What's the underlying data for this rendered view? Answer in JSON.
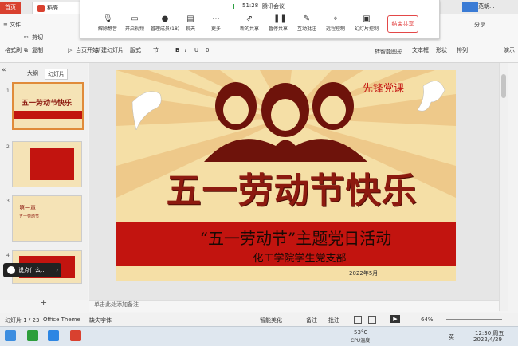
{
  "tabs": {
    "home": "首页",
    "doc_app": "稻壳"
  },
  "meeting": {
    "duration": "51:28",
    "app_name": "腾讯会议",
    "buttons": [
      "解除静音",
      "开启视频",
      "管理成员(18)",
      "聊天",
      "更多",
      "新的共享",
      "暂停共享",
      "互动批注",
      "远程控制",
      "幻灯片控制"
    ],
    "end_share": "结束共享"
  },
  "ribbon": {
    "file_menu": "文件",
    "start": "开始",
    "cut": "剪切",
    "copy": "复制",
    "format_painter": "格式刷",
    "from_current": "当页开始",
    "new_slide": "新建幻灯片",
    "layout": "版式",
    "section": "节",
    "font_size": "0",
    "textbox": "文本框",
    "shape": "形状",
    "arrange": "排列",
    "smart": "转智能图形",
    "share": "分享",
    "play": "演示",
    "right_label": "范朝..."
  },
  "left_panel": {
    "outline_tab": "大纲",
    "slides_tab": "幻灯片",
    "slide_numbers": [
      "1",
      "2",
      "3",
      "4"
    ],
    "add": "+"
  },
  "slide": {
    "corner_text": "先锋党课",
    "main_title": "五一劳动节快乐",
    "subtitle": "“五一劳动节”主题党日活动",
    "org": "化工学院学生党支部",
    "date": "2022年5月"
  },
  "thumb_text": {
    "t1": "五一劳动节快乐",
    "t3": "第一章",
    "t3b": "五一劳动节"
  },
  "chat_popup": "说点什么...",
  "notes_placeholder": "单击此处添加备注",
  "status": {
    "slide_index": "幻灯片 1 / 23",
    "theme": "Office Theme",
    "font_missing": "缺失字体",
    "smart_beautify": "智能美化",
    "notes": "备注",
    "comments": "批注",
    "zoom": "64%"
  },
  "taskbar": {
    "temp": "53°C",
    "cpu": "CPU温度",
    "lang": "英",
    "time": "12:30 周五",
    "date": "2022/4/29"
  }
}
